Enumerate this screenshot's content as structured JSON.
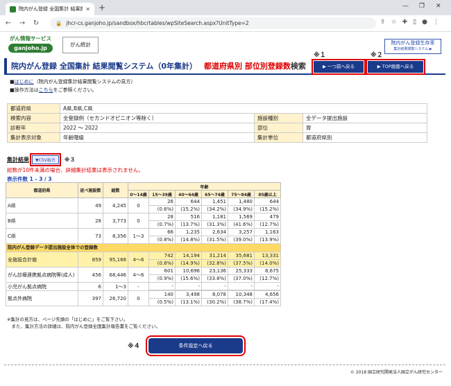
{
  "browser": {
    "tab_title": "院内がん登録 全国集計 結果閲覧",
    "url": "jhcr-cs.ganjoho.jp/sandbox/hbcrtables/wpSiteSearch.aspx?UnitType=2"
  },
  "header": {
    "logo_line1": "がん情報サービス",
    "logo_line2": "ganjoho.jp",
    "gan_toukei": "がん統計",
    "reg_line1": "院内がん登録生存率",
    "reg_line2": "集計結果閲覧システム ▶",
    "mark1": "※１",
    "mark2": "※２",
    "title_main": "院内がん登録 全国集計 結果閲覧システム（0年集計）",
    "title_red": "都道府県別 部位別登録数",
    "title_tail": "検索",
    "back_one": "▶ 一つ前へ戻る",
    "top_page": "▶ TOP画面へ戻る"
  },
  "links": {
    "bullet1_link": "はじめに",
    "bullet1_tail": "（院内がん登録集計結果閲覧システムの見方）",
    "bullet2_head": "操作方法は",
    "bullet2_link": "こちら",
    "bullet2_tail": "をご参照ください。"
  },
  "info": {
    "k1": "都道府県",
    "v1": "A県,B県,C県",
    "k2": "検索内容",
    "v2": "全登録例（セカンドオピニオン等除く）",
    "k3": "施設種別",
    "v3": "全データ提出施設",
    "k4": "診断年",
    "v4": "2022 〜 2022",
    "k5": "部位",
    "v5": "胃",
    "k6": "集計表示対象",
    "v6": "年齢階級",
    "k7": "集計単位",
    "v7": "都道府県別"
  },
  "results": {
    "label": "集計結果",
    "csv": "▼CSV出力",
    "mark3": "※３",
    "warning": "総数が10件未満の場合、詳細集計結果は表示されません。",
    "count": "表示件数 1 - 3 / 3",
    "h_pref": "都道府県",
    "h_fac": "延べ施設数",
    "h_total": "総数",
    "h_age": "年齢",
    "ages": [
      "0〜14歳",
      "15〜39歳",
      "40〜64歳",
      "65〜74歳",
      "75〜84歳",
      "85歳以上"
    ],
    "rows": [
      {
        "name": "A県",
        "fac": "49",
        "total": "4,245",
        "a0": "0",
        "a1": "26",
        "a1p": "(0.6%)",
        "a2": "644",
        "a2p": "(15.2%)",
        "a3": "1,451",
        "a3p": "(34.2%)",
        "a4": "1,480",
        "a4p": "(34.9%)",
        "a5": "644",
        "a5p": "(15.2%)"
      },
      {
        "name": "B県",
        "fac": "28",
        "total": "3,773",
        "a0": "0",
        "a1": "28",
        "a1p": "(0.7%)",
        "a2": "516",
        "a2p": "(13.7%)",
        "a3": "1,181",
        "a3p": "(31.3%)",
        "a4": "1,569",
        "a4p": "(41.6%)",
        "a5": "479",
        "a5p": "(12.7%)"
      },
      {
        "name": "C県",
        "fac": "73",
        "total": "8,356",
        "a0": "1〜3",
        "a1": "66",
        "a1p": "(0.8%)",
        "a2": "1,235",
        "a2p": "(14.8%)",
        "a3": "2,634",
        "a3p": "(31.5%)",
        "a4": "3,257",
        "a4p": "(39.0%)",
        "a5": "1,163",
        "a5p": "(13.9%)"
      }
    ],
    "section": "院内がん登録データ提出施設全体での登録数",
    "rows2": [
      {
        "name": "全施設合計値",
        "fac": "859",
        "total": "95,168",
        "a0": "4〜6",
        "a1": "742",
        "a1p": "(0.8%)",
        "a2": "14,194",
        "a2p": "(14.9%)",
        "a3": "31,214",
        "a3p": "(32.8%)",
        "a4": "35,681",
        "a4p": "(37.5%)",
        "a5": "13,331",
        "a5p": "(14.0%)"
      },
      {
        "name": "がん診療連携拠点病院等(成人)",
        "fac": "456",
        "total": "68,446",
        "a0": "4〜6",
        "a1": "601",
        "a1p": "(0.9%)",
        "a2": "10,696",
        "a2p": "(15.6%)",
        "a3": "23,136",
        "a3p": "(33.8%)",
        "a4": "25,333",
        "a4p": "(37.0%)",
        "a5": "8,675",
        "a5p": "(12.7%)"
      },
      {
        "name": "小児がん拠点病院",
        "fac": "6",
        "total": "1〜3",
        "a0": "-",
        "a1": "-",
        "a1p": "",
        "a2": "-",
        "a2p": "",
        "a3": "-",
        "a3p": "",
        "a4": "-",
        "a4p": "",
        "a5": "-",
        "a5p": ""
      },
      {
        "name": "拠点外病院",
        "fac": "397",
        "total": "26,720",
        "a0": "0",
        "a1": "140",
        "a1p": "(0.5%)",
        "a2": "3,498",
        "a2p": "(13.1%)",
        "a3": "8,078",
        "a3p": "(30.2%)",
        "a4": "10,348",
        "a4p": "(38.7%)",
        "a5": "4,656",
        "a5p": "(17.4%)"
      }
    ]
  },
  "notes": {
    "n1": "※集計の見方は、ページ先頭の「はじめに」をご覧下さい。",
    "n2": "　また、集計方法の詳細は、院内がん登録全国集計報告書をご覧ください。"
  },
  "footer": {
    "mark4": "※４",
    "back_to_cond": "条件設定へ戻る",
    "copyright": "© 2018 国立研究開発法人国立がん研究センター"
  }
}
